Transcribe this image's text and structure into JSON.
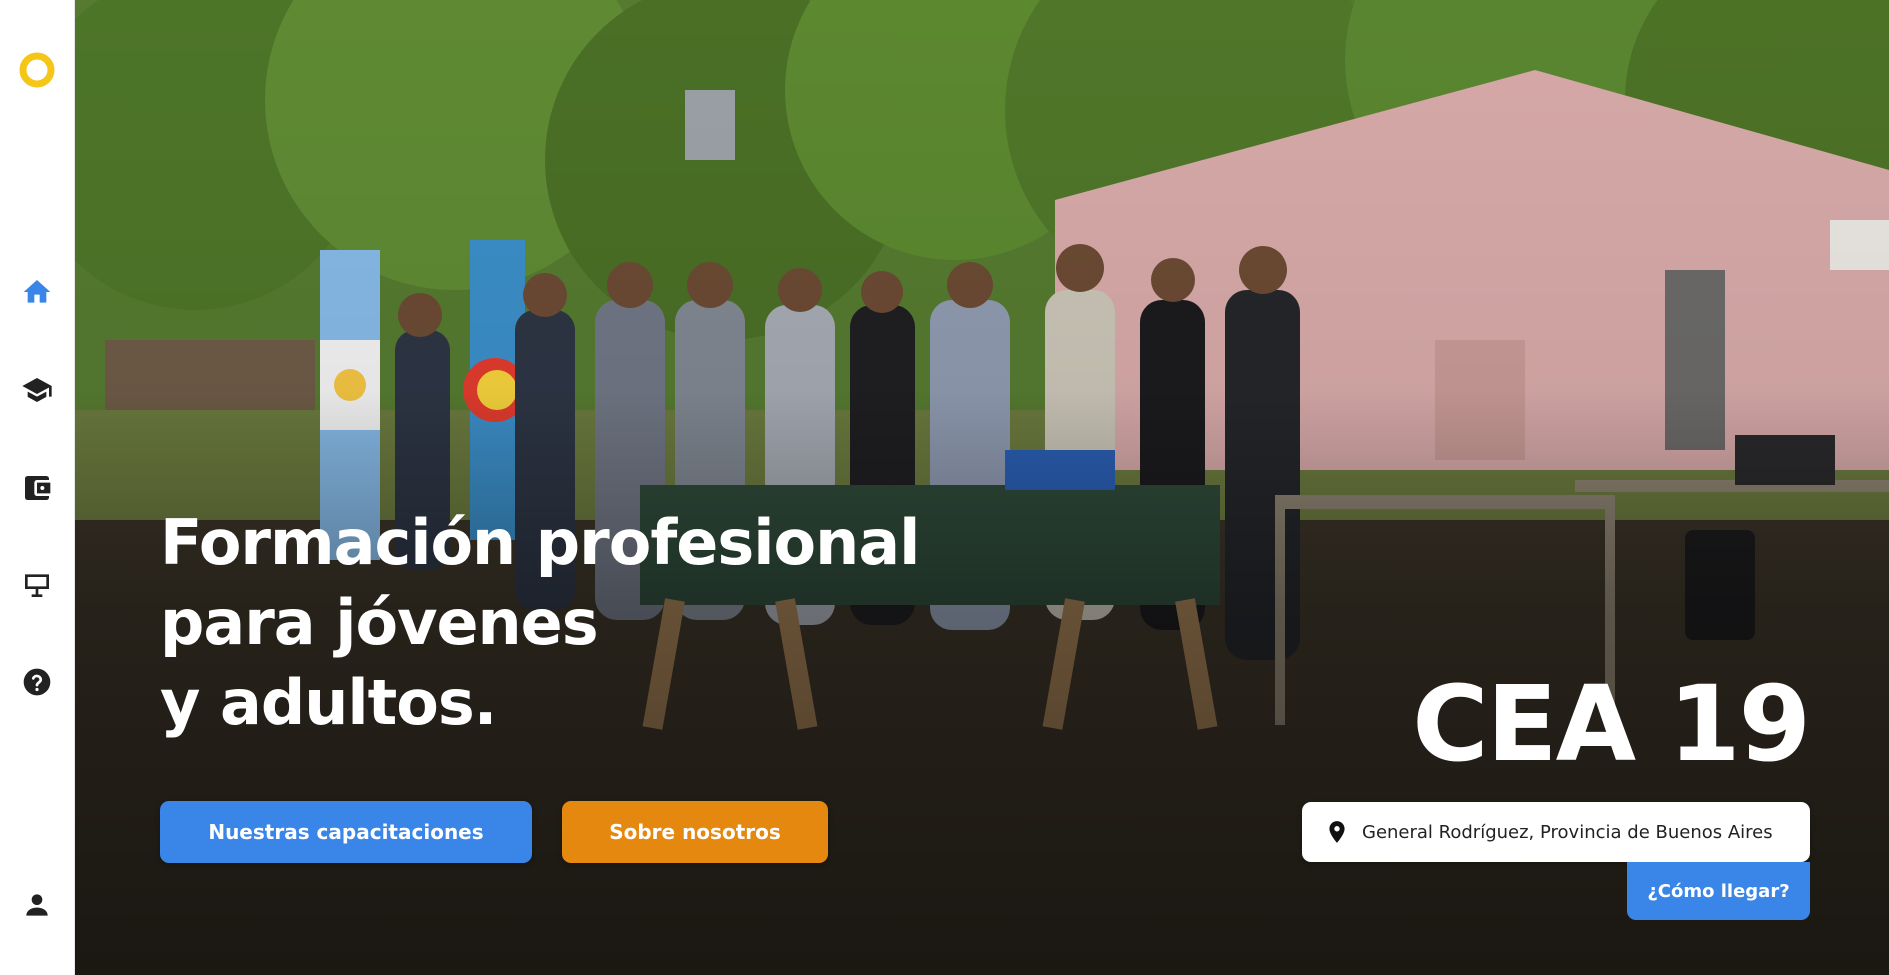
{
  "sidebar": {
    "logo": "ring-logo-icon",
    "items": [
      {
        "icon": "home-icon",
        "active": true
      },
      {
        "icon": "graduation-cap-icon",
        "active": false
      },
      {
        "icon": "wallet-icon",
        "active": false
      },
      {
        "icon": "display-board-icon",
        "active": false
      },
      {
        "icon": "help-circle-icon",
        "active": false
      }
    ],
    "profile_icon": "user-icon"
  },
  "hero": {
    "headline_lines": [
      "Formación profesional",
      "para jóvenes",
      "y adultos."
    ],
    "primary_button": "Nuestras capacitaciones",
    "secondary_button": "Sobre nosotros",
    "school_name": "CEA 19",
    "location": "General Rodríguez, Provincia de Buenos Aires",
    "directions_button": "¿Cómo llegar?",
    "background_photo": "group photo of people standing beside a table with flags in front of a pink building"
  },
  "colors": {
    "accent_blue": "#3a86e8",
    "accent_orange": "#e5880f",
    "logo_yellow": "#f5c518",
    "icon_dark": "#222222"
  }
}
